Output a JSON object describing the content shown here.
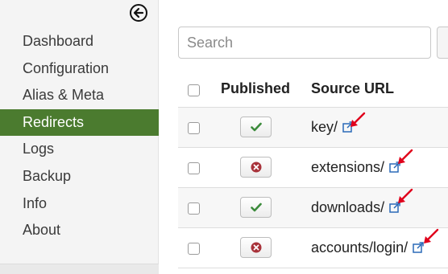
{
  "sidebar": {
    "items": [
      {
        "label": "Dashboard"
      },
      {
        "label": "Configuration"
      },
      {
        "label": "Alias & Meta"
      },
      {
        "label": "Redirects",
        "active": true
      },
      {
        "label": "Logs"
      },
      {
        "label": "Backup"
      },
      {
        "label": "Info"
      },
      {
        "label": "About"
      }
    ],
    "collapse_icon": "circle-arrow-left-icon"
  },
  "search": {
    "placeholder": "Search",
    "value": ""
  },
  "table": {
    "headers": {
      "published": "Published",
      "source_url": "Source URL"
    },
    "rows": [
      {
        "published": true,
        "source_url": "key/"
      },
      {
        "published": false,
        "source_url": "extensions/"
      },
      {
        "published": true,
        "source_url": "downloads/"
      },
      {
        "published": false,
        "source_url": "accounts/login/"
      }
    ]
  },
  "colors": {
    "active_nav": "#4b7b2f",
    "published_check": "#3c8b3c",
    "unpublished_x": "#a8323a",
    "external_link": "#2a6ab8",
    "annotation_arrow": "#e0001b"
  }
}
